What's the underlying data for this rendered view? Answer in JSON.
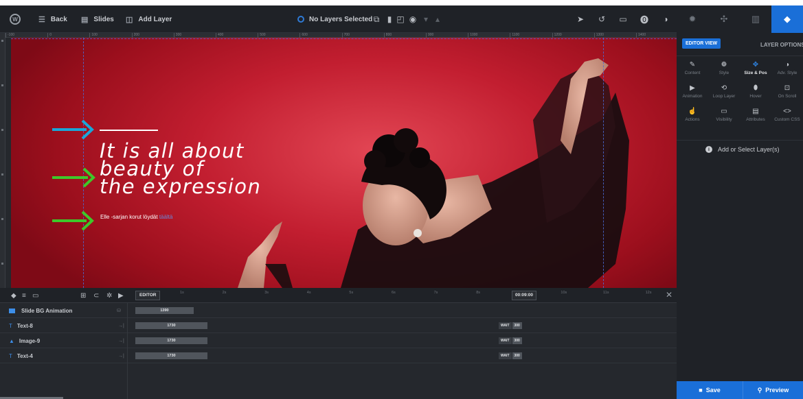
{
  "toolbar": {
    "back_label": "Back",
    "slides_label": "Slides",
    "add_layer_label": "Add Layer",
    "no_layers_label": "No Layers Selected"
  },
  "ruler": {
    "marks": [
      "-100",
      "0",
      "100",
      "200",
      "300",
      "400",
      "500",
      "600",
      "700",
      "800",
      "900",
      "1000",
      "1100",
      "1200",
      "1300",
      "1400"
    ]
  },
  "canvas": {
    "headline": [
      "It is all about",
      "beauty of",
      "the expression"
    ],
    "subtext": "Elle -sarjan korut löydät",
    "subtext_link": "täältä"
  },
  "right_panel": {
    "editor_view_label": "EDITOR VIEW",
    "layer_options_label": "LAYER OPTIONS",
    "options": [
      {
        "label": "Content",
        "icon": "pencil-icon"
      },
      {
        "label": "Style",
        "icon": "palette-icon"
      },
      {
        "label": "Size & Pos",
        "icon": "move-icon"
      },
      {
        "label": "Adv. Style",
        "icon": "contrast-icon"
      },
      {
        "label": "Animation",
        "icon": "play-icon"
      },
      {
        "label": "Loop Layer",
        "icon": "loop-icon"
      },
      {
        "label": "Hover",
        "icon": "mouse-icon"
      },
      {
        "label": "On Scroll",
        "icon": "scroll-icon"
      },
      {
        "label": "Actions",
        "icon": "pointer-icon"
      },
      {
        "label": "Visibility",
        "icon": "monitor-icon"
      },
      {
        "label": "Attributes",
        "icon": "file-icon"
      },
      {
        "label": "Custom CSS",
        "icon": "code-icon"
      }
    ],
    "active_option": "Size & Pos",
    "add_select_label": "Add or Select Layer(s)",
    "save_label": "Save",
    "preview_label": "Preview"
  },
  "timeline": {
    "editor_label": "EDITOR",
    "seconds": [
      "1s",
      "2s",
      "3s",
      "4s",
      "5s",
      "6s",
      "7s",
      "8s",
      "9s",
      "10s",
      "11s",
      "12s"
    ],
    "current_time": "00:09:00",
    "rows": [
      {
        "name": "Slide BG Animation",
        "bar_value": "1390",
        "has_wait": false
      },
      {
        "name": "Text-8",
        "bar_value": "1730",
        "wait_label": "WAIT",
        "wait_value": "300",
        "has_wait": true
      },
      {
        "name": "Image-9",
        "bar_value": "1730",
        "wait_label": "WAIT",
        "wait_value": "300",
        "has_wait": true
      },
      {
        "name": "Text-4",
        "bar_value": "1730",
        "wait_label": "WAIT",
        "wait_value": "300",
        "has_wait": true
      }
    ]
  },
  "colors": {
    "accent": "#1a6fd8",
    "arrow_blue": "#1aa7d8",
    "arrow_green": "#3ec82a",
    "canvas_red": "#c21e30"
  }
}
